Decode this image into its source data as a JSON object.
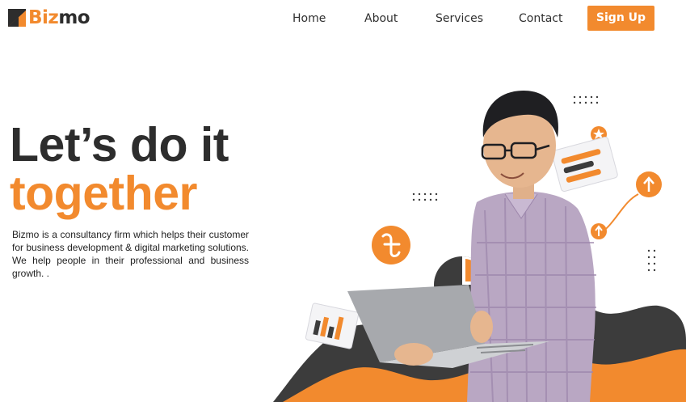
{
  "brand": {
    "name_part1": "Biz",
    "name_part2": "mo",
    "colors": {
      "accent": "#f28a2e",
      "dark": "#2d2d2d"
    }
  },
  "nav": {
    "items": [
      {
        "label": "Home"
      },
      {
        "label": "About"
      },
      {
        "label": "Services"
      },
      {
        "label": "Contact"
      }
    ],
    "cta_label": "Sign Up"
  },
  "hero": {
    "headline_line1": "Let’s do it",
    "headline_line2": "together",
    "description": "Bizmo is a consultancy firm which helps their customer for business development & digital marketing solutions. We help people in their professional and business growth. ."
  },
  "illustration": {
    "icons": [
      "taka-coin-icon",
      "pie-chart-icon",
      "bar-chart-card-icon",
      "growth-arrow-icon",
      "progress-card-icon",
      "star-badge-icon",
      "dot-grid-icon"
    ],
    "subject": "man-with-laptop"
  }
}
